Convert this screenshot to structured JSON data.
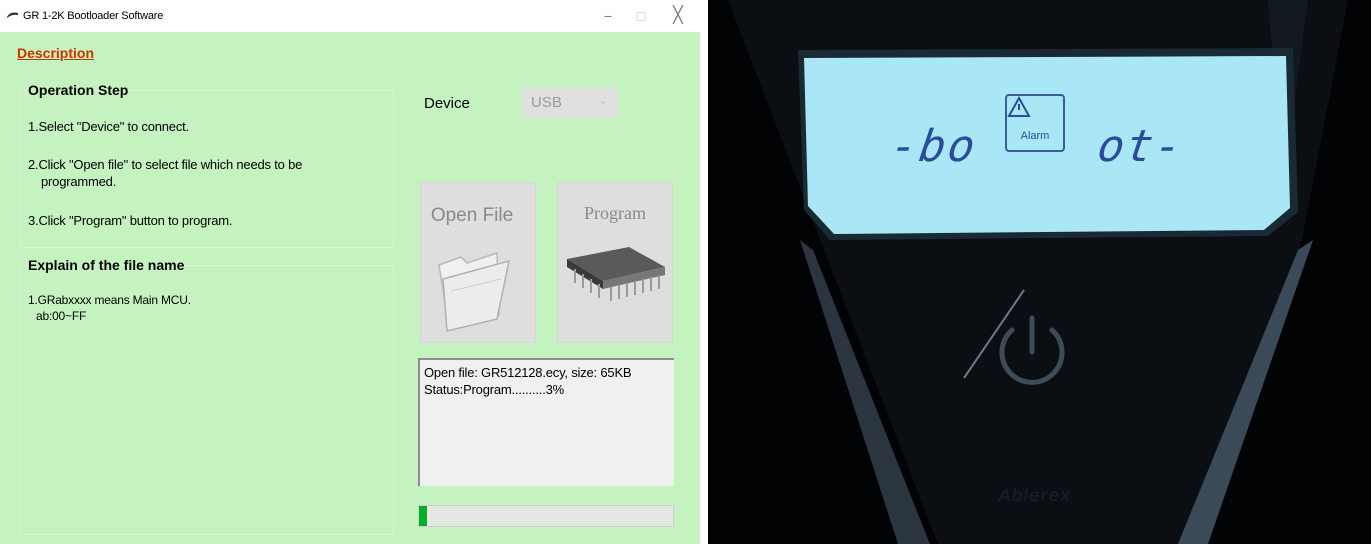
{
  "window": {
    "title": "GR 1-2K Bootloader Software",
    "controls": {
      "minimize": "−",
      "maximize": "□",
      "close": "╳"
    },
    "background": "#c5f3c0"
  },
  "description_link": "Description",
  "operation_step": {
    "title": "Operation Step",
    "steps": [
      "1.Select \"Device\" to connect.",
      "2.Click \"Open file\" to select file which needs  to be",
      "programmed.",
      "3.Click \"Program\" button to program."
    ]
  },
  "explain": {
    "title": "Explain of the file name",
    "lines": [
      "1.GRabxxxx means Main MCU.",
      "ab:00~FF"
    ]
  },
  "device": {
    "label": "Device",
    "selected": "USB"
  },
  "buttons": {
    "open_file": "Open File",
    "program": "Program"
  },
  "log": {
    "lines": [
      "Open file: GR512128.ecy, size: 65KB",
      "Status:Program..........3%"
    ]
  },
  "progress": {
    "percent": 3,
    "color": "#06b025"
  },
  "photo": {
    "lcd_left": "-bo",
    "lcd_right": "ot-",
    "alarm_label": "Alarm",
    "brand": "Ablerex",
    "lcd_color": "#a9e6f6",
    "icons": [
      "alarm-triangle-icon",
      "power-icon"
    ]
  }
}
